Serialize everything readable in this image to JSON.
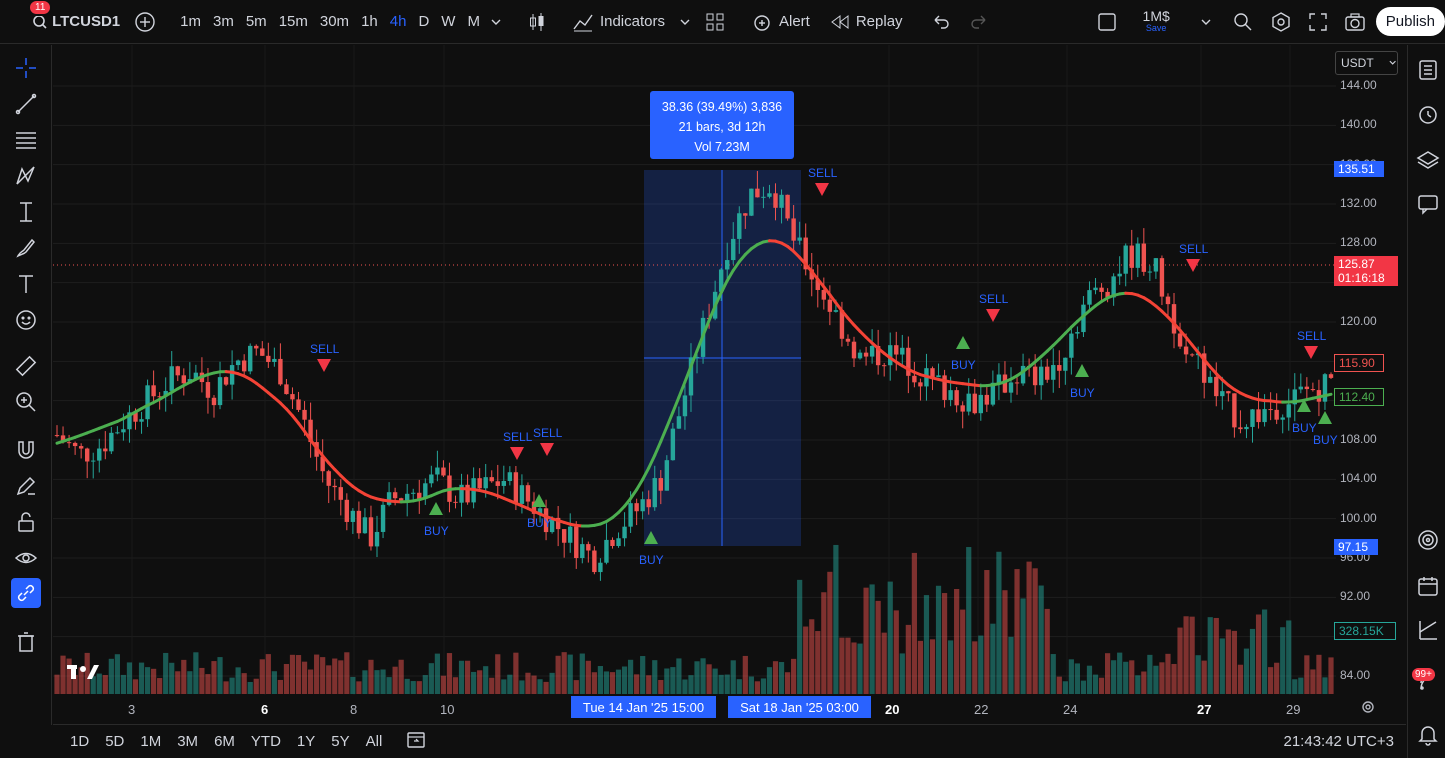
{
  "header": {
    "notification_count": "11",
    "symbol": "LTCUSD1",
    "timeframes": [
      "1m",
      "3m",
      "5m",
      "15m",
      "30m",
      "1h",
      "4h",
      "D",
      "W",
      "M"
    ],
    "active_timeframe": "4h",
    "indicators_label": "Indicators",
    "alert_label": "Alert",
    "replay_label": "Replay",
    "layout_name": "1M$",
    "save_label": "Save",
    "publish_label": "Publish"
  },
  "chart": {
    "currency": "USDT",
    "price_ticks": [
      "144.00",
      "140.00",
      "136.00",
      "132.00",
      "128.00",
      "124.00",
      "120.00",
      "116.00",
      "112.00",
      "108.00",
      "104.00",
      "100.00",
      "96.00",
      "92.00",
      "88.00",
      "84.00"
    ],
    "price_tags": {
      "top": "135.51",
      "last_price": "125.87",
      "countdown": "01:16:18",
      "ma_red": "115.90",
      "ma_green": "112.40",
      "bottom": "97.15",
      "volume": "328.15K"
    },
    "measure": {
      "line1": "38.36 (39.49%) 3,836",
      "line2": "21 bars, 3d 12h",
      "line3": "Vol 7.23M"
    },
    "x_labels": [
      {
        "text": "3",
        "bold": false
      },
      {
        "text": "6",
        "bold": true
      },
      {
        "text": "8",
        "bold": false
      },
      {
        "text": "10",
        "bold": false
      },
      {
        "text": "20",
        "bold": true
      },
      {
        "text": "22",
        "bold": false
      },
      {
        "text": "24",
        "bold": false
      },
      {
        "text": "27",
        "bold": true
      },
      {
        "text": "29",
        "bold": false
      }
    ],
    "time_pills": [
      "Tue 14 Jan '25   15:00",
      "Sat 18 Jan '25   03:00"
    ],
    "signals": {
      "sell": "SELL",
      "buy": "BUY"
    },
    "colors": {
      "up": "#26a69a",
      "down": "#ef5350",
      "ma_up": "#4caf50",
      "ma_down": "#f44336",
      "accent": "#2962ff"
    }
  },
  "chart_data": {
    "type": "candlestick",
    "symbol": "LTCUSD1",
    "interval": "4h",
    "price_min": 84,
    "price_max": 144,
    "close_path": [
      108.5,
      106.5,
      107.5,
      110,
      112,
      114,
      115,
      113,
      116,
      117,
      115,
      110,
      104,
      101,
      98,
      102,
      103,
      104,
      102,
      103,
      104,
      102,
      100,
      98,
      96,
      99,
      101,
      104,
      112,
      120,
      128,
      133,
      134,
      128,
      124,
      120,
      116,
      117,
      116,
      114,
      113,
      112,
      113,
      115,
      114,
      117,
      122,
      124,
      127,
      126,
      120,
      116,
      112,
      110,
      111,
      112,
      113,
      114
    ]
  },
  "bottom": {
    "ranges": [
      "1D",
      "5D",
      "1M",
      "3M",
      "6M",
      "YTD",
      "1Y",
      "5Y",
      "All"
    ],
    "clock": "21:43:42 UTC+3"
  }
}
